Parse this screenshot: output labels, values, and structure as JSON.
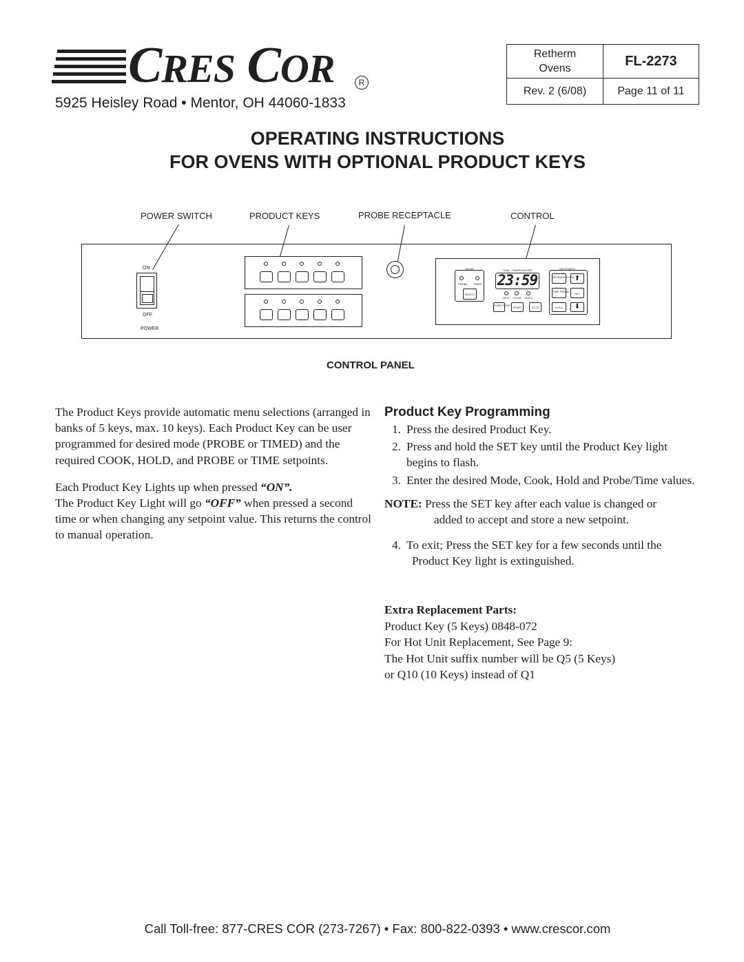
{
  "header": {
    "logo": {
      "brand_word1_cap": "C",
      "brand_word1_rest": "RES",
      "brand_word2_cap": "C",
      "brand_word2_rest": "OR",
      "registered": "R"
    },
    "address": "5925 Heisley Road • Mentor, OH 44060-1833",
    "doc_info": {
      "product_line1": "Retherm",
      "product_line2": "Ovens",
      "form_number": "FL-2273",
      "revision": "Rev. 2 (6/08)",
      "page": "Page 11 of 11"
    }
  },
  "titles": {
    "line1": "OPERATING INSTRUCTIONS",
    "line2": "FOR OVENS WITH OPTIONAL PRODUCT KEYS"
  },
  "diagram": {
    "callouts": {
      "power_switch": "POWER SWITCH",
      "product_keys": "PRODUCT KEYS",
      "probe_receptacle": "PROBE RECEPTACLE",
      "control": "CONTROL"
    },
    "switch_labels": {
      "on": "ON",
      "off": "OFF",
      "power": "POWER"
    },
    "control": {
      "mode_label": "MODE",
      "mode_options": [
        "PROBE",
        "TIMED"
      ],
      "select_label": "SELECT",
      "display_label": "TIME - TEMPERATURE",
      "display_value": "23:59",
      "status_labels": [
        "HEAT",
        "COOK",
        "HOLD"
      ],
      "bottom_buttons": [
        "OVEN TEMP",
        "START",
        "STOP"
      ],
      "setpoints_label": "SETPOINTS",
      "setpoint_buttons": {
        "setback_cook": "SETBACK COOK",
        "time_probe": "TIME PROBE",
        "set": "SET",
        "hold": "HOLD"
      }
    },
    "caption": "CONTROL PANEL"
  },
  "left_column": {
    "para1": "The Product Keys provide automatic menu selections (arranged in banks of 5 keys, max. 10 keys). Each Product Key can be user programmed for desired mode (PROBE or TIMED) and the required COOK, HOLD, and PROBE or TIME setpoints.",
    "para2_pre": "Each Product Key Lights up when pressed ",
    "para2_em": "“ON”.",
    "para3_pre": "The Product Key Light will go ",
    "para3_em": "“OFF”",
    "para3_post": " when pressed a second time or when changing any setpoint value. This returns the control to manual operation."
  },
  "programming": {
    "heading": "Product Key Programming",
    "steps": [
      {
        "num": "1.",
        "text": "Press the desired Product Key."
      },
      {
        "num": "2.",
        "text": "Press and hold the SET key until the Product Key light begins to flash."
      },
      {
        "num": "3.",
        "text": "Enter the desired Mode, Cook, Hold and Probe/Time values."
      }
    ],
    "note_label": "NOTE:",
    "note_text1": " Press the SET key after each value is changed or",
    "note_text2": "added to accept and store a new setpoint.",
    "step4": {
      "num": "4.",
      "text1": "To exit; Press the SET key for a few seconds until the",
      "text2": "Product Key light is extinguished."
    }
  },
  "parts": {
    "heading": "Extra Replacement Parts:",
    "lines": [
      "Product Key (5 Keys) 0848-072",
      "For Hot Unit Replacement, See Page 9:",
      "The Hot Unit suffix number will be Q5 (5 Keys)",
      "or Q10 (10 Keys) instead of Q1"
    ]
  },
  "footer": "Call Toll-free: 877-CRES COR (273-7267) • Fax: 800-822-0393 • www.crescor.com"
}
